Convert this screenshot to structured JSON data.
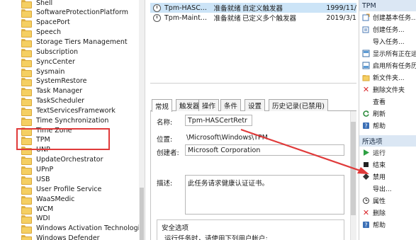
{
  "tree": {
    "items": [
      {
        "label": "Shell"
      },
      {
        "label": "SoftwareProtectionPlatform"
      },
      {
        "label": "SpacePort"
      },
      {
        "label": "Speech"
      },
      {
        "label": "Storage Tiers Management"
      },
      {
        "label": "Subscription"
      },
      {
        "label": "SyncCenter"
      },
      {
        "label": "Sysmain"
      },
      {
        "label": "SystemRestore"
      },
      {
        "label": "Task Manager"
      },
      {
        "label": "TaskScheduler"
      },
      {
        "label": "TextServicesFramework"
      },
      {
        "label": "Time Synchronization"
      },
      {
        "label": "Time Zone"
      },
      {
        "label": "TPM"
      },
      {
        "label": "UNP"
      },
      {
        "label": "UpdateOrchestrator"
      },
      {
        "label": "UPnP"
      },
      {
        "label": "USB"
      },
      {
        "label": "User Profile Service"
      },
      {
        "label": "WaaSMedic"
      },
      {
        "label": "WCM"
      },
      {
        "label": "WDI"
      },
      {
        "label": "Windows Activation Technologies"
      },
      {
        "label": "Windows Defender"
      }
    ]
  },
  "tasks": [
    {
      "name": "Tpm-HASC...",
      "status": "准备就绪",
      "triggers": "自定义触发器",
      "next": "1999/11/"
    },
    {
      "name": "Tpm-Maint...",
      "status": "准备就绪",
      "triggers": "已定义多个触发器",
      "next": "2019/3/1"
    }
  ],
  "detail": {
    "tabs": [
      "常规",
      "触发器",
      "操作",
      "条件",
      "设置",
      "历史记录(已禁用)"
    ],
    "name_label": "名称:",
    "name_value": "Tpm-HASCertRetr",
    "location_label": "位置:",
    "location_value": "\\Microsoft\\Windows\\TPM",
    "author_label": "创建者:",
    "author_value": "Microsoft Corporation",
    "desc_label": "描述:",
    "desc_value": "此任务请求健康认证证书。",
    "security_title": "安全选项",
    "security_text": "运行任务时，请使用下列用户帐户:"
  },
  "actions": {
    "section1_title": "TPM",
    "section1_items": [
      {
        "label": "创建基本任务...",
        "icon": "create-basic-task-icon"
      },
      {
        "label": "创建任务...",
        "icon": "create-task-icon"
      },
      {
        "label": "导入任务...",
        "icon": "import-task-icon"
      },
      {
        "label": "显示所有正在运",
        "icon": "display-running-icon"
      },
      {
        "label": "启用所有任务历",
        "icon": "enable-history-icon"
      },
      {
        "label": "新文件夹...",
        "icon": "new-folder-icon"
      },
      {
        "label": "删除文件夹",
        "icon": "delete-folder-icon"
      },
      {
        "label": "查看",
        "icon": "view-icon"
      },
      {
        "label": "刷新",
        "icon": "refresh-icon"
      },
      {
        "label": "帮助",
        "icon": "help-icon"
      }
    ],
    "section2_title": "所选项",
    "section2_items": [
      {
        "label": "运行",
        "icon": "run-icon"
      },
      {
        "label": "结束",
        "icon": "end-icon"
      },
      {
        "label": "禁用",
        "icon": "disable-icon"
      },
      {
        "label": "导出...",
        "icon": "export-icon"
      },
      {
        "label": "属性",
        "icon": "properties-icon"
      },
      {
        "label": "删除",
        "icon": "delete-icon"
      },
      {
        "label": "帮助",
        "icon": "help-icon"
      }
    ]
  },
  "colors": {
    "annotation": "#e03a3a",
    "header_bg": "#dbe7f4",
    "selection": "#cce4f7"
  }
}
